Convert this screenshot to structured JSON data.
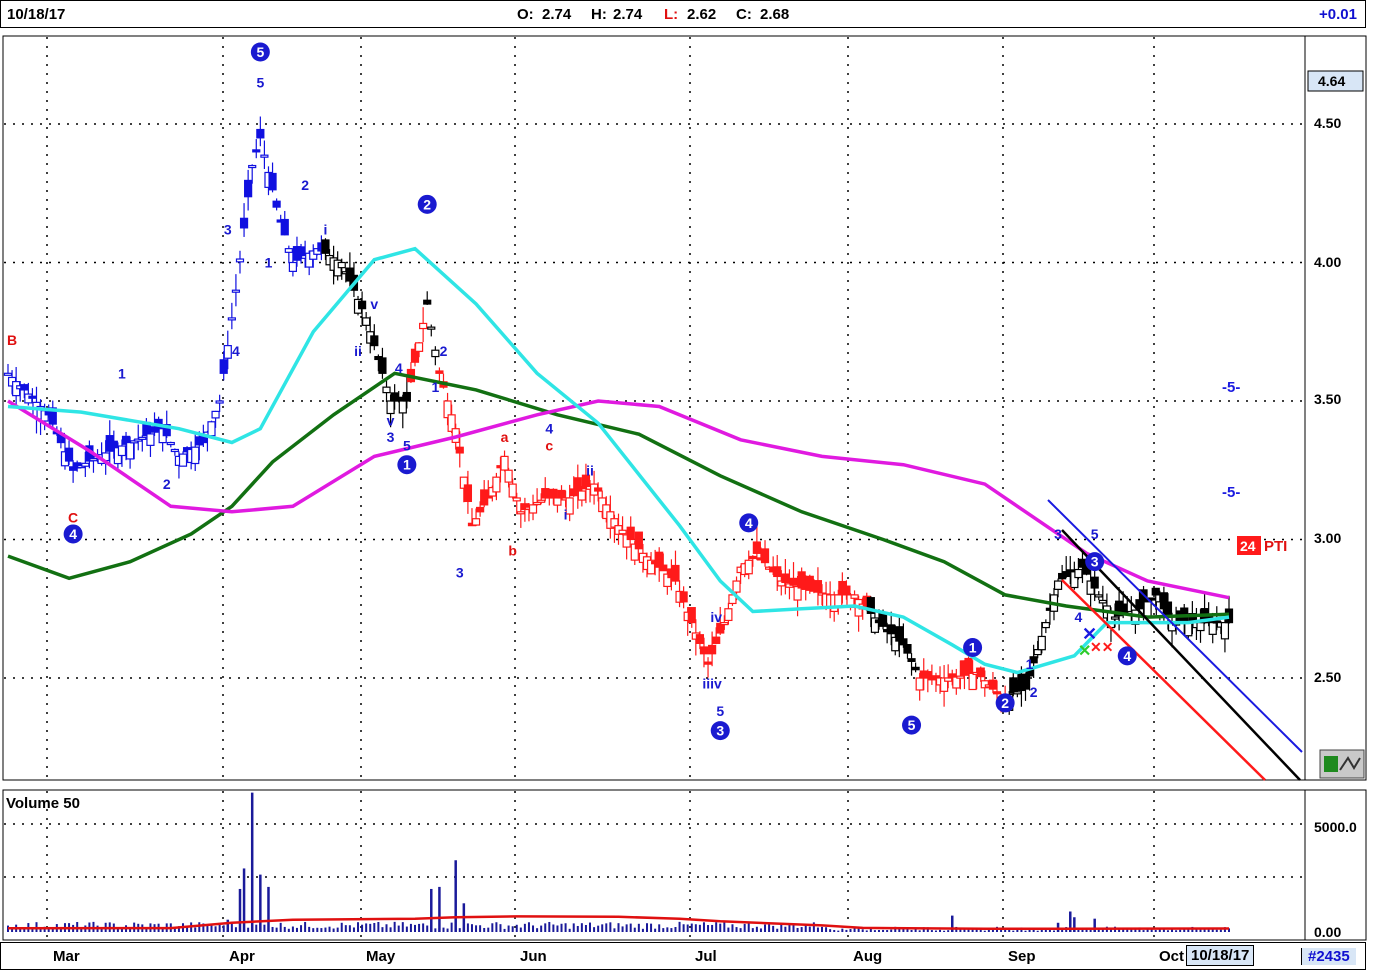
{
  "header": {
    "date": "10/18/17",
    "open_label": "O:",
    "open": "2.74",
    "high_label": "H:",
    "high": "2.74",
    "low_label": "L:",
    "low": "2.62",
    "close_label": "C:",
    "close": "2.68",
    "change": "+0.01"
  },
  "footer": {
    "months": [
      "Mar",
      "Apr",
      "May",
      "Jun",
      "Jul",
      "Aug",
      "Sep",
      "Oct"
    ],
    "date_box": "10/18/17",
    "symbol_count": "#2435"
  },
  "price_panel": {
    "y_ticks": [
      "4.50",
      "4.00",
      "3.50",
      "3.00",
      "2.50"
    ],
    "last_price_box": "4.64",
    "pti_value": "24",
    "pti_label": "PTI",
    "target_labels": [
      "-5-",
      "-5-"
    ]
  },
  "volume_panel": {
    "title": "Volume 50",
    "y_ticks": [
      "5000.0",
      "0.00"
    ]
  },
  "colors": {
    "bull_blue": "#1010e0",
    "bear_red": "#ff1a1a",
    "neutral_black": "#000000",
    "ma_cyan": "#2fe5e5",
    "ma_green": "#127012",
    "ma_magenta": "#e01ae0",
    "count_blue": "#1a1ad0",
    "count_red": "#e01010"
  },
  "chart_data": {
    "type": "candlestick",
    "ylim": [
      2.2,
      4.85
    ],
    "months": [
      "Mar",
      "Apr",
      "May",
      "Jun",
      "Jul",
      "Aug",
      "Sep",
      "Oct"
    ],
    "ma_fast_cyan": [
      [
        0,
        3.48
      ],
      [
        18,
        3.46
      ],
      [
        42,
        3.4
      ],
      [
        55,
        3.35
      ],
      [
        62,
        3.4
      ],
      [
        75,
        3.75
      ],
      [
        90,
        4.01
      ],
      [
        100,
        4.05
      ],
      [
        115,
        3.85
      ],
      [
        130,
        3.6
      ],
      [
        145,
        3.42
      ],
      [
        165,
        3.05
      ],
      [
        175,
        2.85
      ],
      [
        183,
        2.74
      ],
      [
        195,
        2.75
      ],
      [
        208,
        2.76
      ],
      [
        220,
        2.72
      ],
      [
        232,
        2.62
      ],
      [
        240,
        2.55
      ],
      [
        248,
        2.52
      ],
      [
        255,
        2.55
      ],
      [
        262,
        2.58
      ],
      [
        270,
        2.7
      ],
      [
        280,
        2.7
      ],
      [
        290,
        2.7
      ],
      [
        300,
        2.72
      ]
    ],
    "ma_mid_magenta": [
      [
        0,
        3.5
      ],
      [
        20,
        3.32
      ],
      [
        40,
        3.12
      ],
      [
        55,
        3.1
      ],
      [
        70,
        3.12
      ],
      [
        90,
        3.3
      ],
      [
        110,
        3.37
      ],
      [
        130,
        3.45
      ],
      [
        145,
        3.5
      ],
      [
        160,
        3.48
      ],
      [
        180,
        3.36
      ],
      [
        200,
        3.3
      ],
      [
        220,
        3.27
      ],
      [
        240,
        3.2
      ],
      [
        255,
        3.05
      ],
      [
        265,
        2.95
      ],
      [
        280,
        2.85
      ],
      [
        300,
        2.79
      ]
    ],
    "ma_slow_green": [
      [
        0,
        2.94
      ],
      [
        15,
        2.86
      ],
      [
        30,
        2.92
      ],
      [
        45,
        3.02
      ],
      [
        55,
        3.12
      ],
      [
        65,
        3.28
      ],
      [
        80,
        3.45
      ],
      [
        95,
        3.6
      ],
      [
        115,
        3.54
      ],
      [
        135,
        3.45
      ],
      [
        155,
        3.38
      ],
      [
        175,
        3.23
      ],
      [
        195,
        3.1
      ],
      [
        215,
        3.0
      ],
      [
        230,
        2.92
      ],
      [
        245,
        2.8
      ],
      [
        260,
        2.76
      ],
      [
        280,
        2.72
      ],
      [
        300,
        2.73
      ]
    ],
    "volume_avg": [
      [
        0,
        180
      ],
      [
        40,
        190
      ],
      [
        55,
        450
      ],
      [
        70,
        600
      ],
      [
        100,
        650
      ],
      [
        110,
        720
      ],
      [
        125,
        760
      ],
      [
        150,
        740
      ],
      [
        165,
        650
      ],
      [
        175,
        520
      ],
      [
        200,
        320
      ],
      [
        210,
        200
      ],
      [
        240,
        160
      ],
      [
        260,
        160
      ],
      [
        300,
        170
      ]
    ],
    "volume_spikes": [
      [
        54,
        600
      ],
      [
        57,
        2100
      ],
      [
        58,
        3100
      ],
      [
        60,
        6800
      ],
      [
        62,
        2800
      ],
      [
        64,
        2200
      ],
      [
        104,
        2100
      ],
      [
        106,
        2200
      ],
      [
        110,
        3500
      ],
      [
        112,
        1400
      ],
      [
        232,
        800
      ],
      [
        258,
        450
      ],
      [
        261,
        1000
      ],
      [
        262,
        720
      ],
      [
        267,
        650
      ]
    ],
    "wave_labels": [
      {
        "t": "5",
        "x": 62,
        "y": 4.76,
        "c": "b",
        "circle": true
      },
      {
        "t": "5",
        "x": 62,
        "y": 4.65,
        "c": "b"
      },
      {
        "t": "2",
        "x": 103,
        "y": 4.21,
        "c": "b",
        "circle": true
      },
      {
        "t": "B",
        "x": 1,
        "y": 3.72,
        "c": "r"
      },
      {
        "t": "C",
        "x": 16,
        "y": 3.08,
        "c": "r"
      },
      {
        "t": "4",
        "x": 16,
        "y": 3.02,
        "c": "b",
        "circle": true
      },
      {
        "t": "1",
        "x": 28,
        "y": 3.6,
        "c": "b"
      },
      {
        "t": "2",
        "x": 39,
        "y": 3.2,
        "c": "b"
      },
      {
        "t": "3",
        "x": 54,
        "y": 4.12,
        "c": "b"
      },
      {
        "t": "4",
        "x": 56,
        "y": 3.68,
        "c": "b"
      },
      {
        "t": "1",
        "x": 64,
        "y": 4.0,
        "c": "b"
      },
      {
        "t": "2",
        "x": 73,
        "y": 4.28,
        "c": "b"
      },
      {
        "t": "i",
        "x": 78,
        "y": 4.12,
        "c": "b"
      },
      {
        "t": "v",
        "x": 90,
        "y": 3.85,
        "c": "b"
      },
      {
        "t": "ii",
        "x": 86,
        "y": 3.68,
        "c": "b"
      },
      {
        "t": "4",
        "x": 96,
        "y": 3.62,
        "c": "b"
      },
      {
        "t": "v",
        "x": 94,
        "y": 3.43,
        "c": "b"
      },
      {
        "t": "3",
        "x": 94,
        "y": 3.37,
        "c": "b"
      },
      {
        "t": "5",
        "x": 98,
        "y": 3.34,
        "c": "b"
      },
      {
        "t": "1",
        "x": 98,
        "y": 3.27,
        "c": "b",
        "circle": true
      },
      {
        "t": "2",
        "x": 107,
        "y": 3.68,
        "c": "b"
      },
      {
        "t": "1",
        "x": 105,
        "y": 3.55,
        "c": "b"
      },
      {
        "t": "a",
        "x": 122,
        "y": 3.37,
        "c": "r"
      },
      {
        "t": "4",
        "x": 133,
        "y": 3.4,
        "c": "b"
      },
      {
        "t": "c",
        "x": 133,
        "y": 3.34,
        "c": "r"
      },
      {
        "t": "b",
        "x": 124,
        "y": 2.96,
        "c": "r"
      },
      {
        "t": "3",
        "x": 111,
        "y": 2.88,
        "c": "b"
      },
      {
        "t": "ii",
        "x": 143,
        "y": 3.25,
        "c": "b"
      },
      {
        "t": "i",
        "x": 137,
        "y": 3.09,
        "c": "b"
      },
      {
        "t": "4",
        "x": 182,
        "y": 3.06,
        "c": "b",
        "circle": true
      },
      {
        "t": "iv",
        "x": 174,
        "y": 2.72,
        "c": "b"
      },
      {
        "t": "iiiv",
        "x": 173,
        "y": 2.48,
        "c": "b"
      },
      {
        "t": "5",
        "x": 175,
        "y": 2.38,
        "c": "b"
      },
      {
        "t": "3",
        "x": 175,
        "y": 2.31,
        "c": "b",
        "circle": true
      },
      {
        "t": "5",
        "x": 222,
        "y": 2.33,
        "c": "b",
        "circle": true
      },
      {
        "t": "1",
        "x": 237,
        "y": 2.61,
        "c": "b",
        "circle": true
      },
      {
        "t": "2",
        "x": 245,
        "y": 2.41,
        "c": "b",
        "circle": true
      },
      {
        "t": "1",
        "x": 251,
        "y": 2.55,
        "c": "b"
      },
      {
        "t": "2",
        "x": 252,
        "y": 2.45,
        "c": "b"
      },
      {
        "t": "3",
        "x": 267,
        "y": 2.92,
        "c": "b",
        "circle": true
      },
      {
        "t": "3",
        "x": 258,
        "y": 3.02,
        "c": "b"
      },
      {
        "t": "5",
        "x": 267,
        "y": 3.02,
        "c": "b"
      },
      {
        "t": "4",
        "x": 263,
        "y": 2.72,
        "c": "b"
      },
      {
        "t": "4",
        "x": 275,
        "y": 2.58,
        "c": "b",
        "circle": true
      }
    ]
  }
}
